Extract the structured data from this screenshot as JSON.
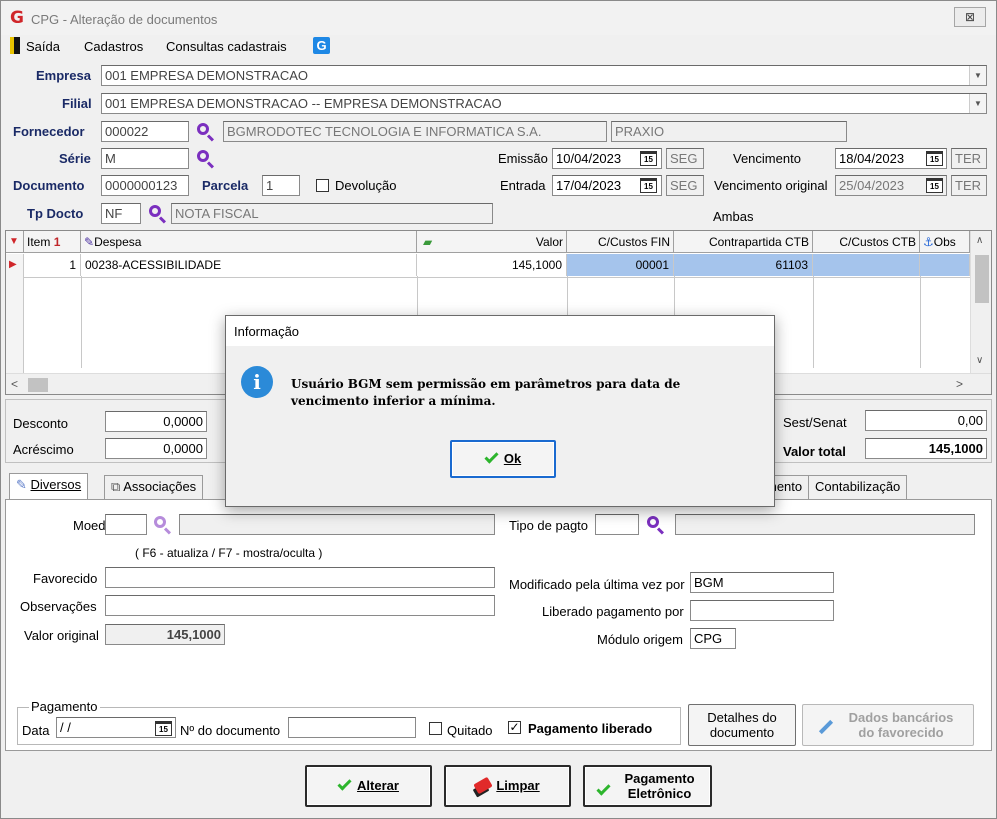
{
  "window": {
    "title": "CPG - Alteração de documentos",
    "close_glyph": "⊠"
  },
  "menu": {
    "exit": "Saída",
    "registers": "Cadastros",
    "queries": "Consultas cadastrais"
  },
  "form": {
    "empresa_label": "Empresa",
    "empresa": "001 EMPRESA DEMONSTRACAO",
    "filial_label": "Filial",
    "filial": "001 EMPRESA DEMONSTRACAO -- EMPRESA DEMONSTRACAO",
    "fornecedor_label": "Fornecedor",
    "fornecedor_code": "000022",
    "fornecedor_name": "BGMRODOTEC TECNOLOGIA E INFORMATICA S.A.",
    "fornecedor_alias": "PRAXIO",
    "serie_label": "Série",
    "serie": "M",
    "documento_label": "Documento",
    "documento": "0000000123",
    "parcela_label": "Parcela",
    "parcela": "1",
    "devolucao_label": "Devolução",
    "tpdocto_label": "Tp Docto",
    "tpdocto_code": "NF",
    "tpdocto_name": "NOTA FISCAL",
    "emissao_label": "Emissão",
    "emissao": "10/04/2023",
    "emissao_day": "SEG",
    "entrada_label": "Entrada",
    "entrada": "17/04/2023",
    "entrada_day": "SEG",
    "vencimento_label": "Vencimento",
    "vencimento": "18/04/2023",
    "vencimento_day": "TER",
    "venc_original_label": "Vencimento original",
    "venc_original": "25/04/2023",
    "venc_original_day": "TER",
    "ambas": "Ambas",
    "cal_glyph": "15"
  },
  "grid": {
    "headers": {
      "item": "Item",
      "item_sort": "1",
      "despesa": "Despesa",
      "valor": "Valor",
      "ccfin": "C/Custos FIN",
      "contrapartida": "Contrapartida CTB",
      "ccctb": "C/Custos CTB",
      "obs": "Obs"
    },
    "rows": [
      {
        "item": "1",
        "despesa": "00238-ACESSIBILIDADE",
        "valor": "145,1000",
        "ccfin": "00001",
        "contrapartida": "61103",
        "ccctb": ""
      }
    ]
  },
  "totals": {
    "desconto_label": "Desconto",
    "desconto": "0,0000",
    "acrescimo_label": "Acréscimo",
    "acrescimo": "0,0000",
    "sestsenat_label": "Sest/Senat",
    "sestsenat": "0,00",
    "valortotal_label": "Valor total",
    "valortotal": "145,1000"
  },
  "tabs": {
    "diversos": "Diversos",
    "associacoes": "Associações",
    "mento": "mento",
    "contabilizacao": "Contabilização"
  },
  "diversos": {
    "moeda_label": "Moeda",
    "hint": "( F6 - atualiza / F7 - mostra/oculta )",
    "favorecido_label": "Favorecido",
    "observacoes_label": "Observações",
    "valor_original_label": "Valor original",
    "valor_original": "145,1000",
    "tipo_pagto_label": "Tipo de pagto",
    "modificado_label": "Modificado pela última vez por",
    "modificado": "BGM",
    "liberado_label": "Liberado pagamento por",
    "modulo_label": "Módulo origem",
    "modulo": "CPG",
    "pagamento_title": "Pagamento",
    "data_label": "Data",
    "data": " / /",
    "ndoc_label": "Nº do documento",
    "quitado_label": "Quitado",
    "pag_liberado_label": "Pagamento liberado",
    "detalhes_label_1": "Detalhes do",
    "detalhes_label_2": "documento",
    "dados_bancarios_1": "Dados bancários",
    "dados_bancarios_2": "do favorecido"
  },
  "buttons": {
    "alterar": "Alterar",
    "limpar": "Limpar",
    "pag_eletronico_1": "Pagamento",
    "pag_eletronico_2": "Eletrônico"
  },
  "dialog": {
    "title": "Informação",
    "message_1": "Usuário BGM sem permissão em parâmetros para data de",
    "message_2": "vencimento inferior a mínima.",
    "ok": "Ok"
  }
}
